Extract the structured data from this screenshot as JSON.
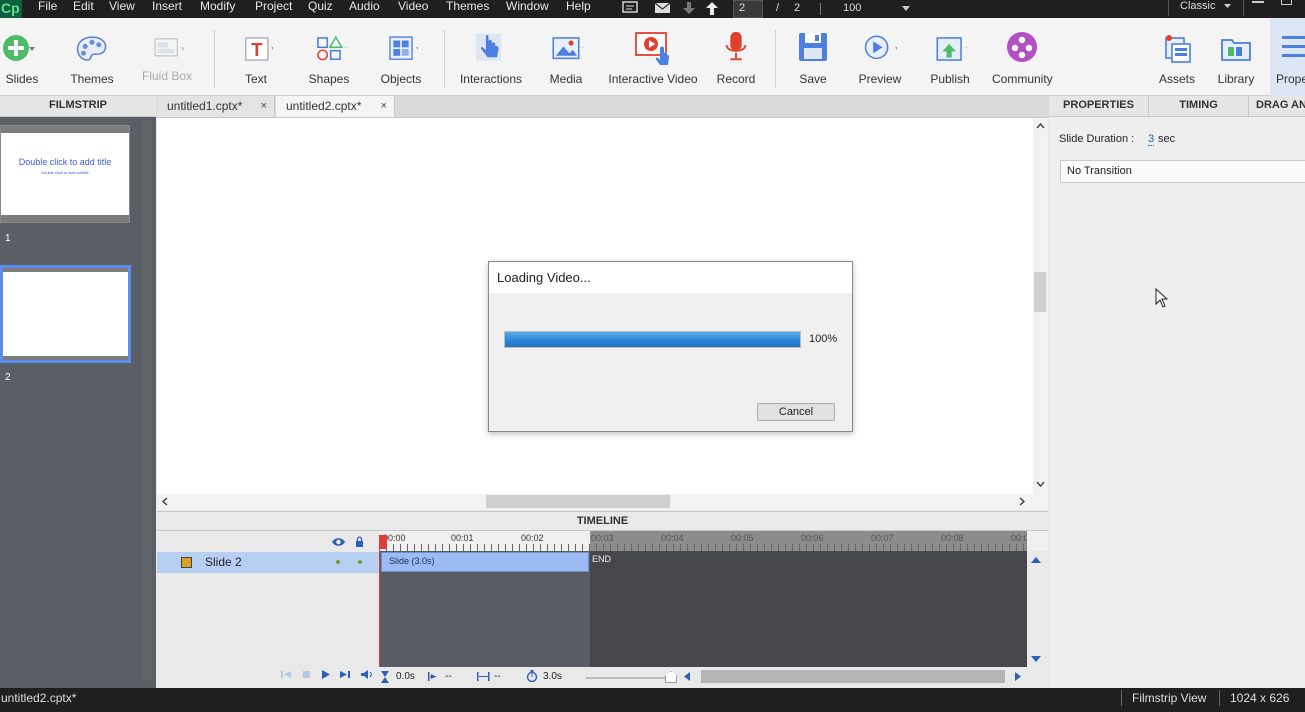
{
  "menubar": {
    "logo": "Cp",
    "items": [
      "File",
      "Edit",
      "View",
      "Insert",
      "Modify",
      "Project",
      "Quiz",
      "Audio",
      "Video",
      "Themes",
      "Window",
      "Help"
    ],
    "current_slide": "2",
    "slide_sep": "/",
    "total_slides": "2",
    "zoom": "100",
    "workspace": "Classic"
  },
  "toolbar": {
    "buttons": [
      {
        "label": "Slides",
        "icon": "add-slide-icon"
      },
      {
        "label": "Themes",
        "icon": "palette-icon"
      },
      {
        "label": "Fluid Box",
        "icon": "fluid-box-icon"
      },
      {
        "label": "Text",
        "icon": "text-icon"
      },
      {
        "label": "Shapes",
        "icon": "shapes-icon"
      },
      {
        "label": "Objects",
        "icon": "objects-icon"
      },
      {
        "label": "Interactions",
        "icon": "hand-pointer-icon"
      },
      {
        "label": "Media",
        "icon": "image-icon"
      },
      {
        "label": "Interactive Video",
        "icon": "interactive-video-icon"
      },
      {
        "label": "Record",
        "icon": "microphone-icon"
      },
      {
        "label": "Save",
        "icon": "save-icon"
      },
      {
        "label": "Preview",
        "icon": "play-icon"
      },
      {
        "label": "Publish",
        "icon": "publish-icon"
      },
      {
        "label": "Community",
        "icon": "community-icon"
      },
      {
        "label": "Assets",
        "icon": "assets-icon"
      },
      {
        "label": "Library",
        "icon": "library-icon"
      },
      {
        "label": "Prope",
        "icon": "properties-icon"
      }
    ]
  },
  "filmstrip": {
    "header": "FILMSTRIP",
    "slides": [
      {
        "number": "1",
        "title": "Double click to add title",
        "subtitle": "Double click to add subtitle"
      },
      {
        "number": "2"
      }
    ]
  },
  "tabs": [
    {
      "label": "untitled1.cptx*",
      "close": "×"
    },
    {
      "label": "untitled2.cptx*",
      "close": "×"
    }
  ],
  "dialog": {
    "title": "Loading Video...",
    "progress": 1.0,
    "progress_text": "100%",
    "cancel_label": "Cancel"
  },
  "timeline": {
    "header": "TIMELINE",
    "ticks": [
      "00:00",
      "00:01",
      "00:02",
      "00:03",
      "00:04",
      "00:05",
      "00:06",
      "00:07",
      "00:08",
      "00:0"
    ],
    "layer_name": "Slide 2",
    "slide_bar_label": "Slide (3.0s)",
    "end_label": "END",
    "current_time": "0.0s",
    "in_time": "--",
    "duration_mark": "--",
    "slide_duration": "3.0s"
  },
  "properties": {
    "tabs": [
      "PROPERTIES",
      "TIMING",
      "DRAG AND"
    ],
    "slide_duration_label": "Slide Duration :",
    "slide_duration_value": "3",
    "slide_duration_unit": "sec",
    "transition": "No Transition"
  },
  "status": {
    "filename": "untitled2.cptx*",
    "view": "Filmstrip View",
    "resolution": "1024 x 626"
  },
  "colors": {
    "accent": "#4d7fe0",
    "progress": "#2b86d6",
    "timeline_bar": "#9dbbf4",
    "playhead": "#e03a3a"
  }
}
